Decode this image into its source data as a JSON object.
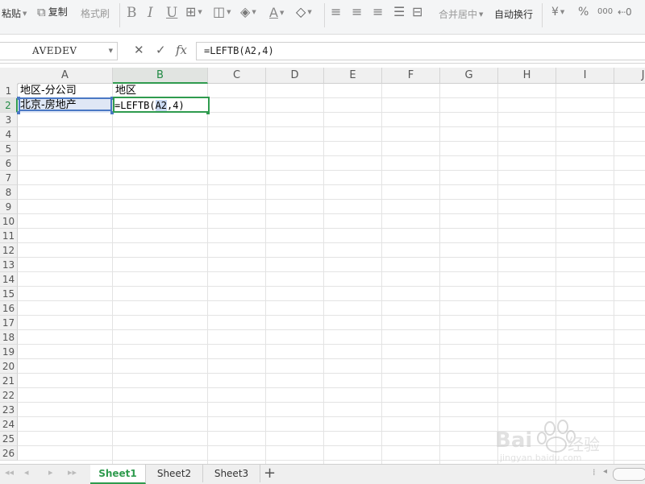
{
  "toolbar": {
    "paste_label": "粘贴",
    "copy_label": "复制",
    "format_painter_label": "格式刷",
    "bold_label": "B",
    "italic_label": "I",
    "underline_label": "U",
    "font_color_label": "A",
    "merge_center_label": "合并居中",
    "wrap_text_label": "自动换行",
    "currency_label": "¥",
    "percent_label": "%",
    "thousands_label": "000"
  },
  "formula_bar": {
    "name_box": "AVEDEV",
    "cancel_label": "✕",
    "enter_label": "✓",
    "fx_label": "fx",
    "formula": "=LEFTB(A2,4)"
  },
  "grid": {
    "columns": [
      "A",
      "B",
      "C",
      "D",
      "E",
      "F",
      "G",
      "H",
      "I",
      "J"
    ],
    "selected_column": "B",
    "rows": [
      "1",
      "2",
      "3",
      "4",
      "5",
      "6",
      "7",
      "8",
      "9",
      "10",
      "11",
      "12",
      "13",
      "14",
      "15",
      "16",
      "17",
      "18",
      "19",
      "20",
      "21",
      "22",
      "23",
      "24",
      "25",
      "26"
    ],
    "selected_row": "2",
    "cells": {
      "A1": "地区-分公司",
      "B1": "地区",
      "A2": "北京-房地产",
      "B2_prefix": "=LEFTB(",
      "B2_ref": "A2",
      "B2_suffix": ",4)"
    }
  },
  "sheets": {
    "tabs": [
      "Sheet1",
      "Sheet2",
      "Sheet3"
    ],
    "active": "Sheet1",
    "add_label": "+"
  },
  "watermark": {
    "brand": "Bai",
    "brand_cn": "经验",
    "url": "jingyan.baidu.com"
  },
  "colors": {
    "accent_green": "#2f9b4e",
    "selection_blue": "#4a78c4",
    "reference_fill": "#c9d8f0"
  }
}
